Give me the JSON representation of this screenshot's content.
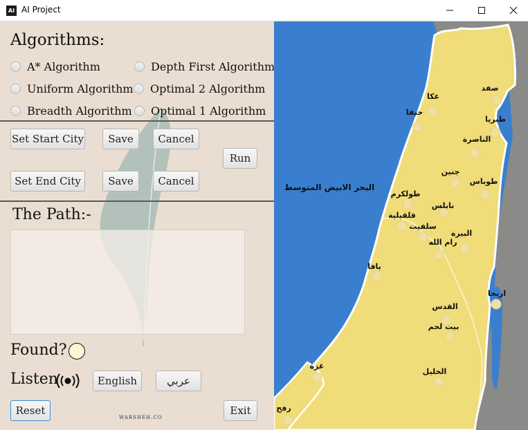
{
  "window": {
    "title": "AI Project",
    "icon_text": "AI",
    "controls": [
      "minimize",
      "maximize",
      "close"
    ]
  },
  "algorithms": {
    "heading": "Algorithms:",
    "options": [
      {
        "label": "A* Algorithm",
        "selected": false
      },
      {
        "label": "Depth First Algorithm",
        "selected": false
      },
      {
        "label": "Uniform Algorithm",
        "selected": false
      },
      {
        "label": "Optimal 2 Algorithm",
        "selected": false
      },
      {
        "label": "Breadth Algorithm",
        "selected": false
      },
      {
        "label": "Optimal 1 Algorithm",
        "selected": false
      }
    ]
  },
  "controls": {
    "set_start_city": "Set Start City",
    "save_start": "Save",
    "cancel_start": "Cancel",
    "run": "Run",
    "set_end_city": "Set End City",
    "save_end": "Save",
    "cancel_end": "Cancel"
  },
  "path": {
    "heading": "The Path:-",
    "value": ""
  },
  "found": {
    "label": "Found?",
    "indicator_color": "#fbf7d3"
  },
  "listen": {
    "label": "Listen",
    "icon": "broadcast-icon",
    "english": "English",
    "arabic": "عربي"
  },
  "footer": {
    "reset": "Reset",
    "exit": "Exit",
    "watermark": "WARSHEH.CO"
  },
  "map": {
    "sea_label": "البحر الابيض المتوسط",
    "colors": {
      "sea": "#3a7fcf",
      "land": "#f0dc78",
      "neighbor": "#8a8a88",
      "border": "#ffffff",
      "marker": "#efe0a0"
    },
    "cities": [
      {
        "name": "صفد"
      },
      {
        "name": "عكا"
      },
      {
        "name": "حيفا"
      },
      {
        "name": "طبريا"
      },
      {
        "name": "الناصرة"
      },
      {
        "name": "جنين"
      },
      {
        "name": "طوباس"
      },
      {
        "name": "طولكرم"
      },
      {
        "name": "نابلس"
      },
      {
        "name": "قلقيلية"
      },
      {
        "name": "سلفيت"
      },
      {
        "name": "البيرة"
      },
      {
        "name": "رام الله"
      },
      {
        "name": "يافا"
      },
      {
        "name": "اريحا"
      },
      {
        "name": "القدس"
      },
      {
        "name": "بيت لحم"
      },
      {
        "name": "غزة"
      },
      {
        "name": "الخليل"
      },
      {
        "name": "رفح"
      }
    ]
  }
}
